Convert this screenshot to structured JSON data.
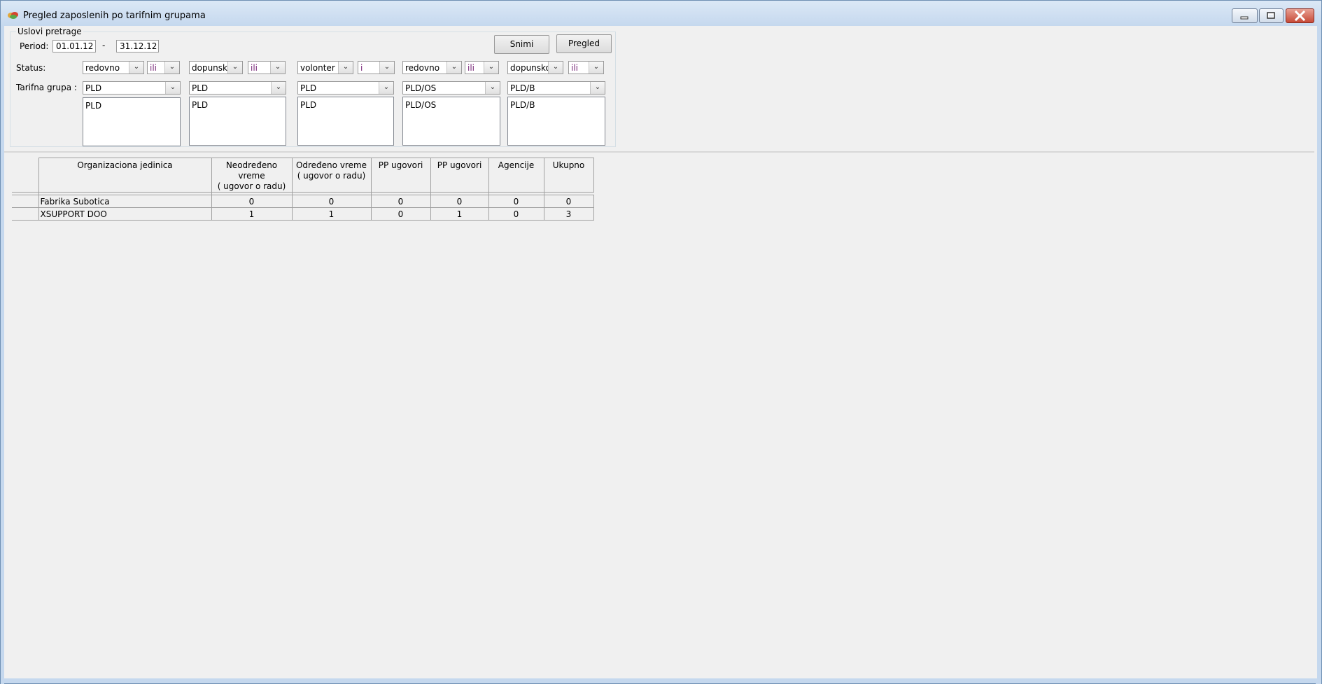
{
  "window": {
    "title": "Pregled zaposlenih po tarifnim grupama",
    "icon": "app-icon",
    "controls": [
      "minimize-icon",
      "restore-icon",
      "close-icon"
    ]
  },
  "search": {
    "group_label": "Uslovi pretrage",
    "period_label": "Period:",
    "date_from": "01.01.12",
    "date_sep": "-",
    "date_to": "31.12.12",
    "save_button": "Snimi",
    "view_button": "Pregled",
    "status_label": "Status:",
    "tarif_label": "Tarifna grupa :",
    "columns": [
      {
        "status": "redovno",
        "op": "ili",
        "tarif": "PLD",
        "list": [
          "PLD"
        ]
      },
      {
        "status": "dopunsko",
        "op": "ili",
        "tarif": "PLD",
        "list": [
          "PLD"
        ]
      },
      {
        "status": "volonter",
        "op": "i",
        "tarif": "PLD",
        "list": [
          "PLD"
        ]
      },
      {
        "status": "redovno",
        "op": "ili",
        "tarif": "PLD/OS",
        "list": [
          "PLD/OS"
        ]
      },
      {
        "status": "dopunsko",
        "op": "ili",
        "tarif": "PLD/B",
        "list": [
          "PLD/B"
        ]
      }
    ]
  },
  "grid": {
    "headers": [
      "Organizaciona jedinica",
      "Neodređeno vreme\n( ugovor o radu)",
      "Određeno vreme\n( ugovor o radu)",
      "PP ugovori",
      "PP ugovori",
      "Agencije",
      "Ukupno"
    ],
    "rows": [
      [
        "Fabrika Subotica",
        "0",
        "0",
        "0",
        "0",
        "0",
        "0"
      ],
      [
        "XSUPPORT DOO",
        "1",
        "1",
        "0",
        "1",
        "0",
        "3"
      ]
    ]
  }
}
